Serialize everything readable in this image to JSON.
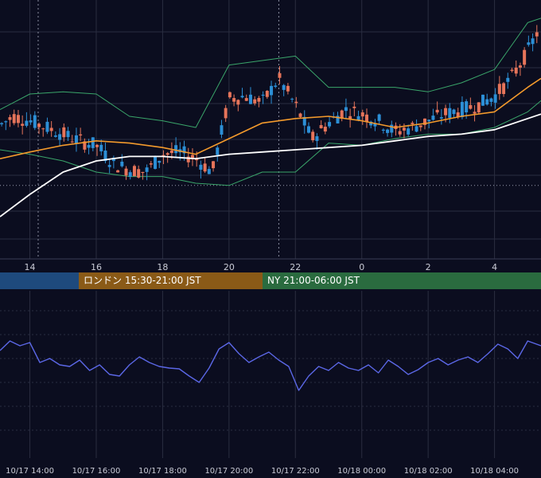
{
  "colors": {
    "background": "#0b0d1f",
    "grid": "#2a2d40",
    "bullish": "#2c8fd6",
    "bearish": "#e6745a",
    "bollinger": "#3aa56a",
    "ma_short": "#f39a2c",
    "ma_long": "#ffffff",
    "oscillator": "#5b67e6",
    "session_tokyo": "#1e4a7d",
    "session_london": "#8a5a17",
    "session_ny": "#2a6b3f"
  },
  "sessions": [
    {
      "label": "",
      "color": "#1e4a7d"
    },
    {
      "label": "ロンドン 15:30-21:00 JST",
      "color": "#8a5a17"
    },
    {
      "label": "NY 21:00-06:00 JST",
      "color": "#2a6b3f"
    }
  ],
  "chart_data": [
    {
      "type": "candlestick",
      "title": "",
      "x_tick_labels": [
        "14",
        "16",
        "18",
        "20",
        "22",
        "0",
        "2",
        "4"
      ],
      "x_hours": [
        14,
        16,
        18,
        20,
        22,
        24,
        26,
        28
      ],
      "x_range": [
        13.1,
        29.4
      ],
      "y_range": [
        0,
        100
      ],
      "grid": true,
      "indicators": [
        "Bollinger Bands",
        "Moving Average (short)",
        "Moving Average (long)"
      ],
      "close_series": {
        "x_hours": [
          13.1,
          13.5,
          14,
          14.5,
          15,
          15.5,
          16,
          16.5,
          17,
          17.5,
          18,
          18.5,
          19,
          19.5,
          20,
          20.5,
          21,
          21.5,
          22,
          22.5,
          23,
          23.5,
          24,
          24.5,
          25,
          25.5,
          26,
          26.5,
          27,
          27.5,
          28,
          28.5,
          29,
          29.4
        ],
        "values": [
          51,
          55,
          53,
          50,
          47,
          44,
          42,
          34,
          31,
          30,
          38,
          39,
          36,
          30,
          63,
          64,
          61,
          72,
          60,
          45,
          52,
          58,
          56,
          53,
          48,
          50,
          53,
          56,
          58,
          60,
          64,
          72,
          84,
          96
        ]
      },
      "ma_short": {
        "x_hours": [
          13.1,
          14,
          15,
          16,
          17,
          18,
          19,
          20,
          21,
          22,
          23,
          24,
          25,
          26,
          27,
          28,
          29,
          29.4
        ],
        "values": [
          36,
          39,
          42,
          44,
          43,
          41,
          38,
          45,
          52,
          54,
          55,
          53,
          50,
          52,
          55,
          57,
          68,
          72
        ]
      },
      "ma_long": {
        "x_hours": [
          13.1,
          14,
          15,
          16,
          17,
          18,
          19,
          20,
          21,
          22,
          23,
          24,
          25,
          26,
          27,
          28,
          29,
          29.4
        ],
        "values": [
          10,
          20,
          30,
          35,
          37,
          37,
          36,
          38,
          39,
          40,
          41,
          42,
          44,
          46,
          47,
          49,
          54,
          56
        ]
      },
      "bollinger_upper": {
        "x_hours": [
          13.1,
          14,
          15,
          16,
          17,
          18,
          19,
          20,
          21,
          22,
          23,
          24,
          25,
          26,
          27,
          28,
          29,
          29.4
        ],
        "values": [
          58,
          65,
          66,
          65,
          55,
          53,
          50,
          78,
          80,
          82,
          68,
          68,
          68,
          66,
          70,
          76,
          97,
          99
        ]
      },
      "bollinger_lower": {
        "x_hours": [
          13.1,
          14,
          15,
          16,
          17,
          18,
          19,
          20,
          21,
          22,
          23,
          24,
          25,
          26,
          27,
          28,
          29,
          29.4
        ],
        "values": [
          40,
          38,
          35,
          30,
          28,
          28,
          25,
          24,
          30,
          30,
          43,
          42,
          45,
          47,
          47,
          50,
          57,
          62
        ]
      },
      "horizontal_line": 24
    },
    {
      "type": "line",
      "title": "",
      "x_tick_labels": [
        "10/17 14:00",
        "10/17 16:00",
        "10/17 18:00",
        "10/17 20:00",
        "10/17 22:00",
        "10/18 00:00",
        "10/18 02:00",
        "10/18 04:00"
      ],
      "x_hours": [
        14,
        16,
        18,
        20,
        22,
        24,
        26,
        28
      ],
      "y_range": [
        0,
        100
      ],
      "grid": true,
      "series": [
        {
          "x_hours": [
            13.1,
            13.4,
            13.7,
            14,
            14.3,
            14.6,
            14.9,
            15.2,
            15.5,
            15.8,
            16.1,
            16.4,
            16.7,
            17.0,
            17.3,
            17.6,
            17.9,
            18.2,
            18.5,
            18.8,
            19.1,
            19.4,
            19.7,
            20.0,
            20.3,
            20.6,
            20.9,
            21.2,
            21.5,
            21.8,
            22.1,
            22.4,
            22.7,
            23.0,
            23.3,
            23.6,
            23.9,
            24.2,
            24.5,
            24.8,
            25.1,
            25.4,
            25.7,
            26.0,
            26.3,
            26.6,
            26.9,
            27.2,
            27.5,
            27.8,
            28.1,
            28.4,
            28.7,
            29.0,
            29.4
          ],
          "values": [
            70,
            82,
            76,
            80,
            55,
            60,
            52,
            50,
            58,
            45,
            52,
            40,
            38,
            52,
            62,
            55,
            50,
            48,
            47,
            38,
            30,
            48,
            72,
            80,
            66,
            55,
            62,
            68,
            58,
            50,
            20,
            38,
            50,
            45,
            55,
            48,
            45,
            52,
            42,
            58,
            50,
            40,
            46,
            55,
            60,
            52,
            58,
            62,
            55,
            66,
            78,
            72,
            60,
            82,
            76
          ]
        }
      ]
    }
  ]
}
